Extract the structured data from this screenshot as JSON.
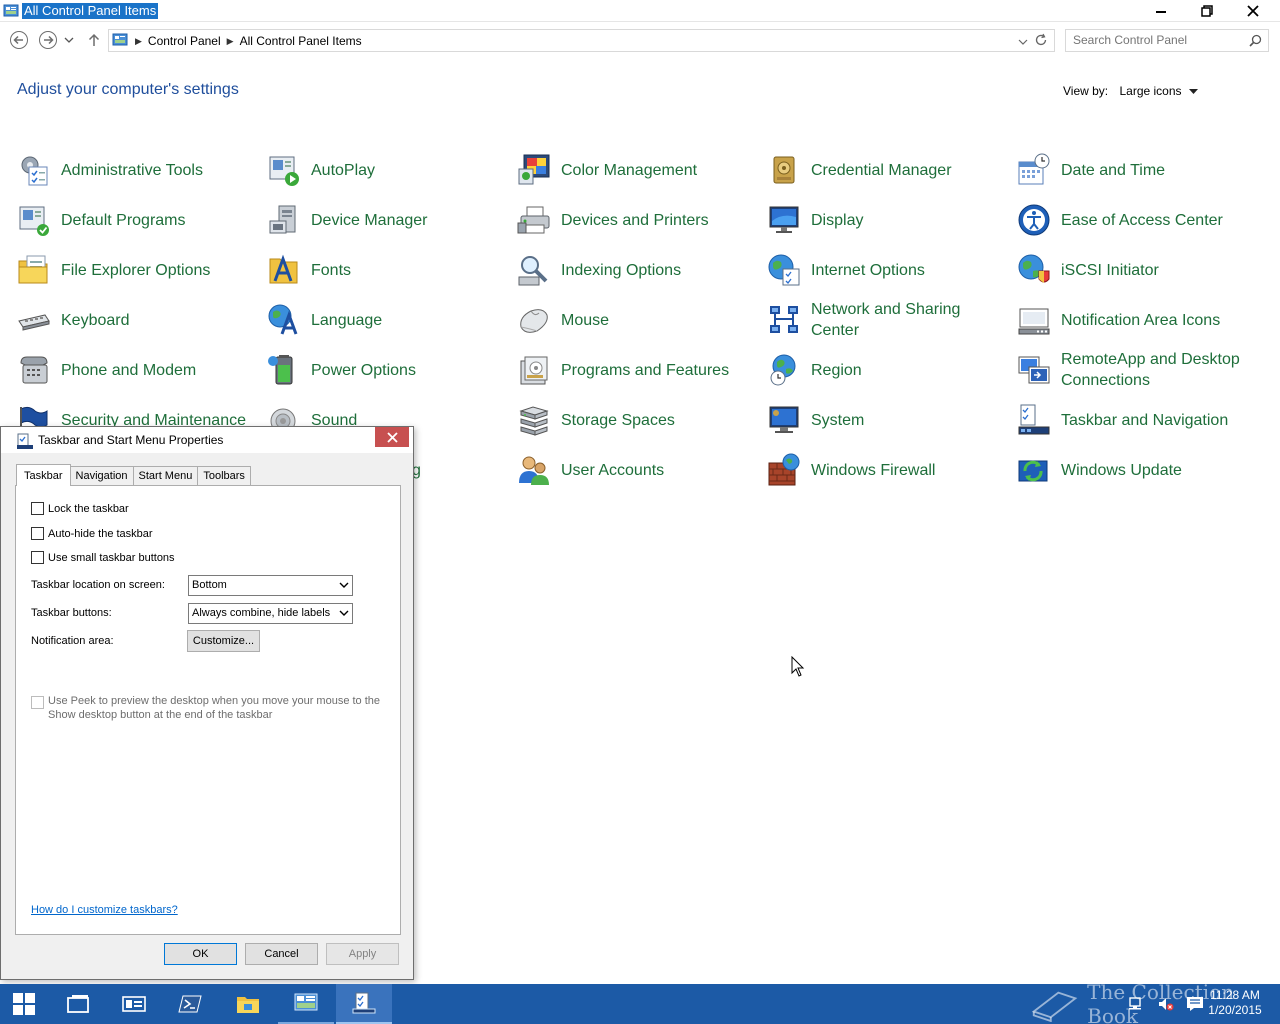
{
  "window": {
    "title": "All Control Panel Items",
    "breadcrumbs": [
      "Control Panel",
      "All Control Panel Items"
    ],
    "search_placeholder": "Search Control Panel"
  },
  "header": {
    "heading": "Adjust your computer's settings",
    "view_by_label": "View by:",
    "view_by_value": "Large icons"
  },
  "items": [
    {
      "label": "Administrative Tools",
      "icon": "administrative-tools-icon"
    },
    {
      "label": "AutoPlay",
      "icon": "autoplay-icon"
    },
    {
      "label": "Color Management",
      "icon": "color-management-icon"
    },
    {
      "label": "Credential Manager",
      "icon": "credential-manager-icon"
    },
    {
      "label": "Date and Time",
      "icon": "date-time-icon"
    },
    {
      "label": "Default Programs",
      "icon": "default-programs-icon"
    },
    {
      "label": "Device Manager",
      "icon": "device-manager-icon"
    },
    {
      "label": "Devices and Printers",
      "icon": "devices-printers-icon"
    },
    {
      "label": "Display",
      "icon": "display-icon"
    },
    {
      "label": "Ease of Access Center",
      "icon": "ease-of-access-icon"
    },
    {
      "label": "File Explorer Options",
      "icon": "file-explorer-options-icon"
    },
    {
      "label": "Fonts",
      "icon": "fonts-icon"
    },
    {
      "label": "Indexing Options",
      "icon": "indexing-options-icon"
    },
    {
      "label": "Internet Options",
      "icon": "internet-options-icon"
    },
    {
      "label": "iSCSI Initiator",
      "icon": "iscsi-initiator-icon"
    },
    {
      "label": "Keyboard",
      "icon": "keyboard-icon"
    },
    {
      "label": "Language",
      "icon": "language-icon"
    },
    {
      "label": "Mouse",
      "icon": "mouse-icon"
    },
    {
      "label": "Network and Sharing Center",
      "icon": "network-sharing-icon"
    },
    {
      "label": "Notification Area Icons",
      "icon": "notification-area-icon"
    },
    {
      "label": "Phone and Modem",
      "icon": "phone-modem-icon"
    },
    {
      "label": "Power Options",
      "icon": "power-options-icon"
    },
    {
      "label": "Programs and Features",
      "icon": "programs-features-icon"
    },
    {
      "label": "Region",
      "icon": "region-icon"
    },
    {
      "label": "RemoteApp and Desktop Connections",
      "icon": "remoteapp-icon"
    },
    {
      "label": "Security and Maintenance",
      "icon": "security-maintenance-icon"
    },
    {
      "label": "Sound",
      "icon": "sound-icon"
    },
    {
      "label": "Storage Spaces",
      "icon": "storage-spaces-icon"
    },
    {
      "label": "System",
      "icon": "system-icon"
    },
    {
      "label": "Taskbar and Navigation",
      "icon": "taskbar-navigation-icon"
    },
    {
      "label": "g",
      "icon": ""
    },
    {
      "label": "User Accounts",
      "icon": "user-accounts-icon"
    },
    {
      "label": "Windows Firewall",
      "icon": "windows-firewall-icon"
    },
    {
      "label": "Windows Update",
      "icon": "windows-update-icon"
    }
  ],
  "dialog": {
    "title": "Taskbar and Start Menu Properties",
    "tabs": [
      "Taskbar",
      "Navigation",
      "Start Menu",
      "Toolbars"
    ],
    "lock_taskbar": "Lock the taskbar",
    "auto_hide": "Auto-hide the taskbar",
    "small_buttons": "Use small taskbar buttons",
    "location_label": "Taskbar location on screen:",
    "location_value": "Bottom",
    "buttons_label": "Taskbar buttons:",
    "buttons_value": "Always combine, hide labels",
    "notification_label": "Notification area:",
    "customize_label": "Customize...",
    "peek_line1": "Use Peek to preview the desktop when you move your mouse to the",
    "peek_line2": "Show desktop button at the end of the taskbar",
    "help_link": "How do I customize taskbars?",
    "ok_label": "OK",
    "cancel_label": "Cancel",
    "apply_label": "Apply"
  },
  "taskbar": {
    "watermark": "The Collection Book",
    "time": "11:28 AM",
    "date": "1/20/2015"
  },
  "colors": {
    "accent": "#1c5aa6",
    "link_green": "#1e6e3a",
    "heading_blue": "#1f4e9c"
  }
}
